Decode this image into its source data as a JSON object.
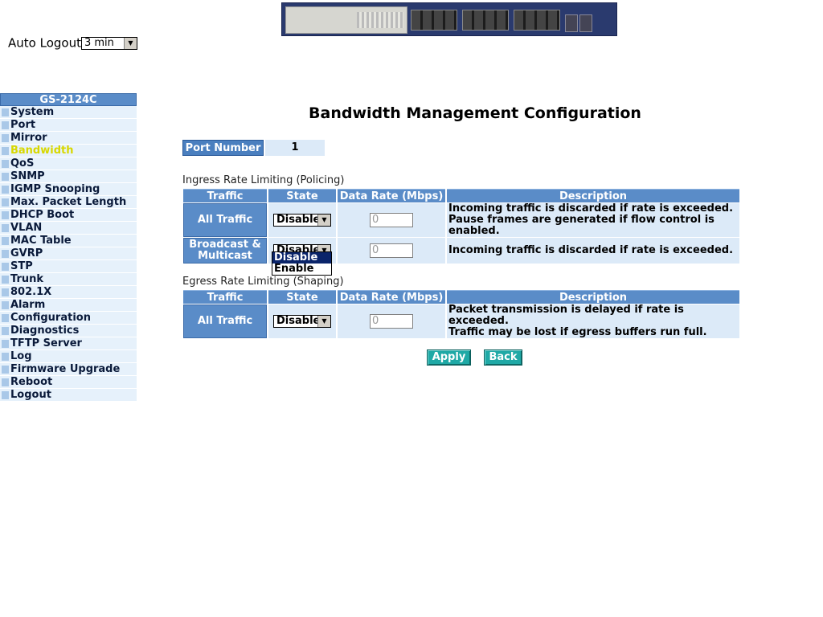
{
  "auto_logout": {
    "label": "Auto Logout",
    "value": "3 min"
  },
  "sidebar": {
    "header": "GS-2124C",
    "active": "Bandwidth",
    "items": [
      "System",
      "Port",
      "Mirror",
      "Bandwidth",
      "QoS",
      "SNMP",
      "IGMP Snooping",
      "Max. Packet Length",
      "DHCP Boot",
      "VLAN",
      "MAC Table",
      "GVRP",
      "STP",
      "Trunk",
      "802.1X",
      "Alarm",
      "Configuration",
      "Diagnostics",
      "TFTP Server",
      "Log",
      "Firmware Upgrade",
      "Reboot",
      "Logout"
    ]
  },
  "page": {
    "title": "Bandwidth Management Configuration",
    "port_number_label": "Port Number",
    "port_number_value": "1"
  },
  "ingress": {
    "title": "Ingress Rate Limiting (Policing)",
    "headers": [
      "Traffic",
      "State",
      "Data Rate (Mbps)",
      "Description"
    ],
    "rows": [
      {
        "traffic": "All Traffic",
        "state": "Disable",
        "rate": "0",
        "desc1": "Incoming traffic is discarded if rate is exceeded.",
        "desc2": "Pause frames are generated if flow control is enabled."
      },
      {
        "traffic1": "Broadcast &",
        "traffic2": "Multicast",
        "state": "Disable",
        "rate": "0",
        "desc1": "Incoming traffic is discarded if rate is exceeded."
      }
    ]
  },
  "dropdown_open": {
    "options": [
      "Disable",
      "Enable"
    ],
    "highlighted": "Disable"
  },
  "egress": {
    "title": "Egress Rate Limiting (Shaping)",
    "headers": [
      "Traffic",
      "State",
      "Data Rate (Mbps)",
      "Description"
    ],
    "rows": [
      {
        "traffic": "All Traffic",
        "state": "Disable",
        "rate": "0",
        "desc1": "Packet transmission is delayed if rate is exceeded.",
        "desc2": "Traffic may be lost if egress buffers run full."
      }
    ]
  },
  "buttons": {
    "apply": "Apply",
    "back": "Back"
  }
}
